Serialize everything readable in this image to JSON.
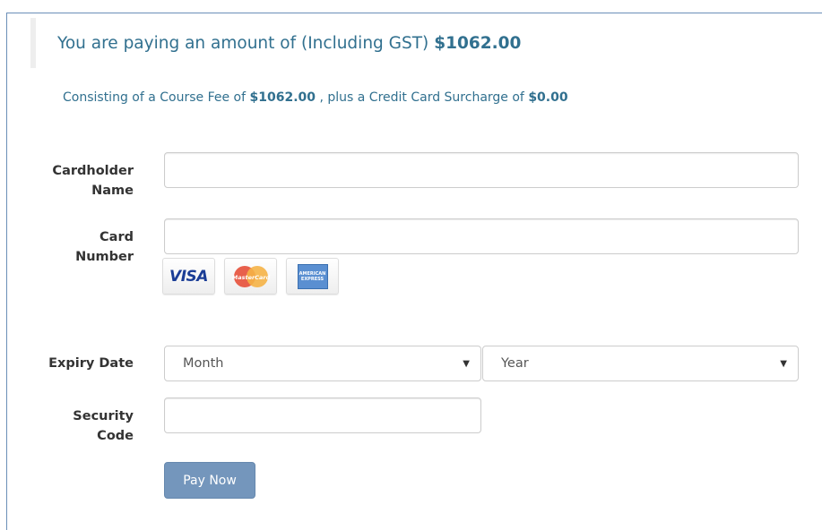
{
  "summary": {
    "prefix": "You are paying an amount of (Including GST)",
    "amount": "$1062.00"
  },
  "breakdown": {
    "text1": "Consisting of a Course Fee of",
    "course_fee": "$1062.00",
    "text2": ", plus a Credit Card Surcharge of",
    "surcharge": "$0.00"
  },
  "form": {
    "cardholder_label_line1": "Cardholder",
    "cardholder_label_line2": "Name",
    "cardholder_value": "",
    "card_number_label_line1": "Card",
    "card_number_label_line2": "Number",
    "card_number_value": "",
    "expiry_label": "Expiry Date",
    "month_selected": "Month",
    "year_selected": "Year",
    "security_label_line1": "Security",
    "security_label_line2": "Code",
    "security_value": ""
  },
  "cards": {
    "visa": "VISA",
    "mastercard": "MasterCard",
    "amex": "AMERICAN EXPRESS"
  },
  "pay_button_label": "Pay Now",
  "colors": {
    "info_text": "#31708f",
    "button": "#7496bc",
    "frame_border": "#6b8fb8"
  }
}
